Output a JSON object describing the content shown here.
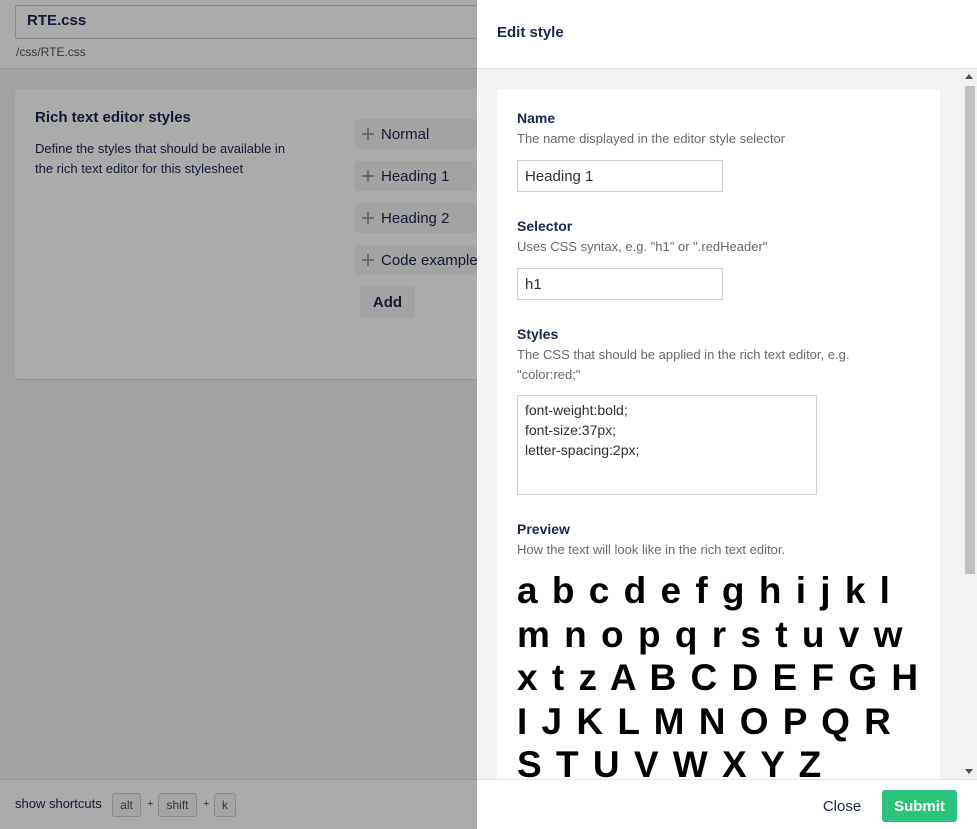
{
  "file": {
    "name": "RTE.css",
    "path": "/css/RTE.css"
  },
  "rte": {
    "title": "Rich text editor styles",
    "description": "Define the styles that should be available in the rich text editor for this stylesheet",
    "items": [
      {
        "label": "Normal"
      },
      {
        "label": "Heading 1"
      },
      {
        "label": "Heading 2"
      },
      {
        "label": "Code examples"
      }
    ],
    "add_label": "Add"
  },
  "shortcuts": {
    "label": "show shortcuts",
    "keys": [
      "alt",
      "shift",
      "k"
    ],
    "separator": "+"
  },
  "panel": {
    "title": "Edit style",
    "name_field": {
      "label": "Name",
      "description": "The name displayed in the editor style selector",
      "value": "Heading 1"
    },
    "selector_field": {
      "label": "Selector",
      "description": "Uses CSS syntax, e.g. \"h1\" or \".redHeader\"",
      "value": "h1"
    },
    "styles_field": {
      "label": "Styles",
      "description": "The CSS that should be applied in the rich text editor, e.g. \"color:red;\"",
      "value": "font-weight:bold;\nfont-size:37px;\nletter-spacing:2px;"
    },
    "preview": {
      "label": "Preview",
      "description": "How the text will look like in the rich text editor.",
      "text": "a b c d e f g h i j k l m n o p q r s t u v w x t z A B C D E F G H I J K L M N O P Q R S T U V W X Y Z"
    },
    "close_label": "Close",
    "submit_label": "Submit"
  },
  "colors": {
    "submit": "#2bc37c",
    "text": "#1b264f"
  }
}
